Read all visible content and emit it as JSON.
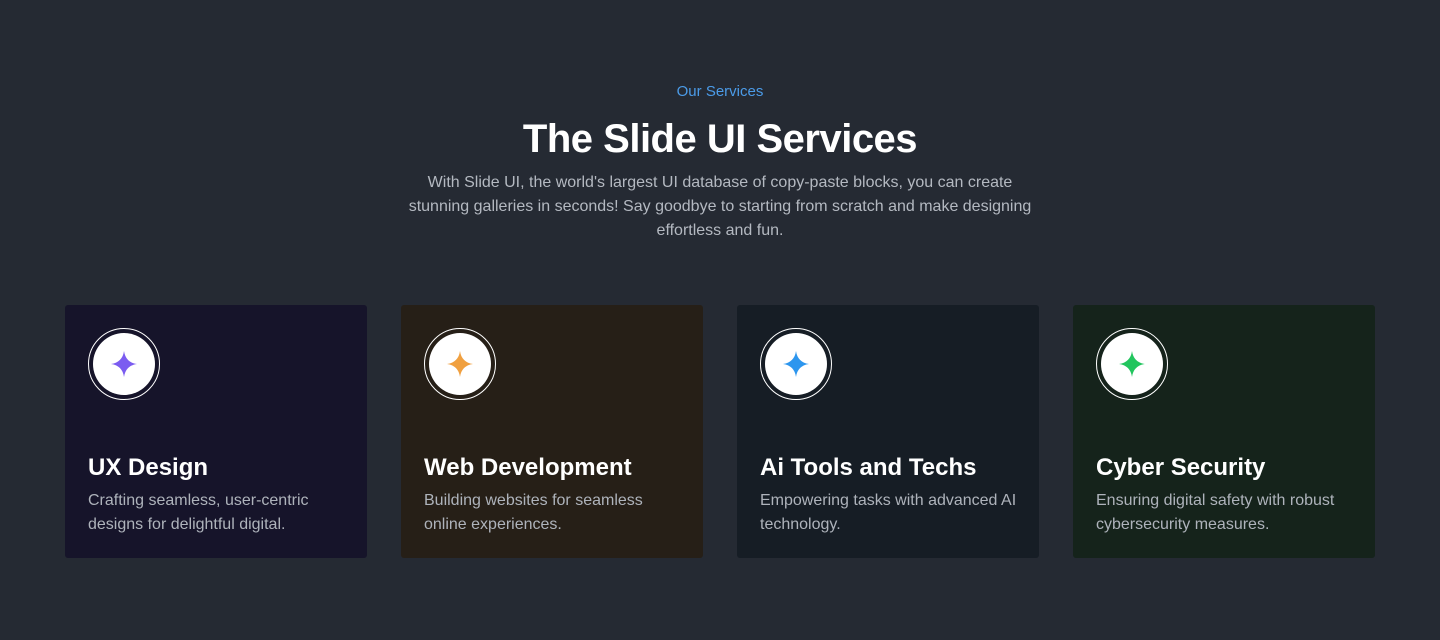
{
  "header": {
    "eyebrow": "Our Services",
    "title": "The Slide UI Services",
    "subtitle": "With Slide UI, the world's largest UI database of copy-paste blocks, you can create stunning galleries in seconds! Say goodbye to starting from scratch and make designing effortless and fun."
  },
  "cards": [
    {
      "title": "UX Design",
      "description": "Crafting seamless, user-centric designs for delightful digital.",
      "icon": "sparkle-icon",
      "accent": "#7b5cf0",
      "background": "#16142a"
    },
    {
      "title": "Web Development",
      "description": "Building websites for seamless online experiences.",
      "icon": "sparkle-icon",
      "accent": "#f0a040",
      "background": "#261f17"
    },
    {
      "title": "Ai Tools and Techs",
      "description": "Empowering tasks with advanced AI technology.",
      "icon": "sparkle-icon",
      "accent": "#2d96ee",
      "background": "#161d25"
    },
    {
      "title": "Cyber Security",
      "description": "Ensuring digital safety with robust cybersecurity measures.",
      "icon": "sparkle-icon",
      "accent": "#22c55e",
      "background": "#15231b"
    }
  ]
}
